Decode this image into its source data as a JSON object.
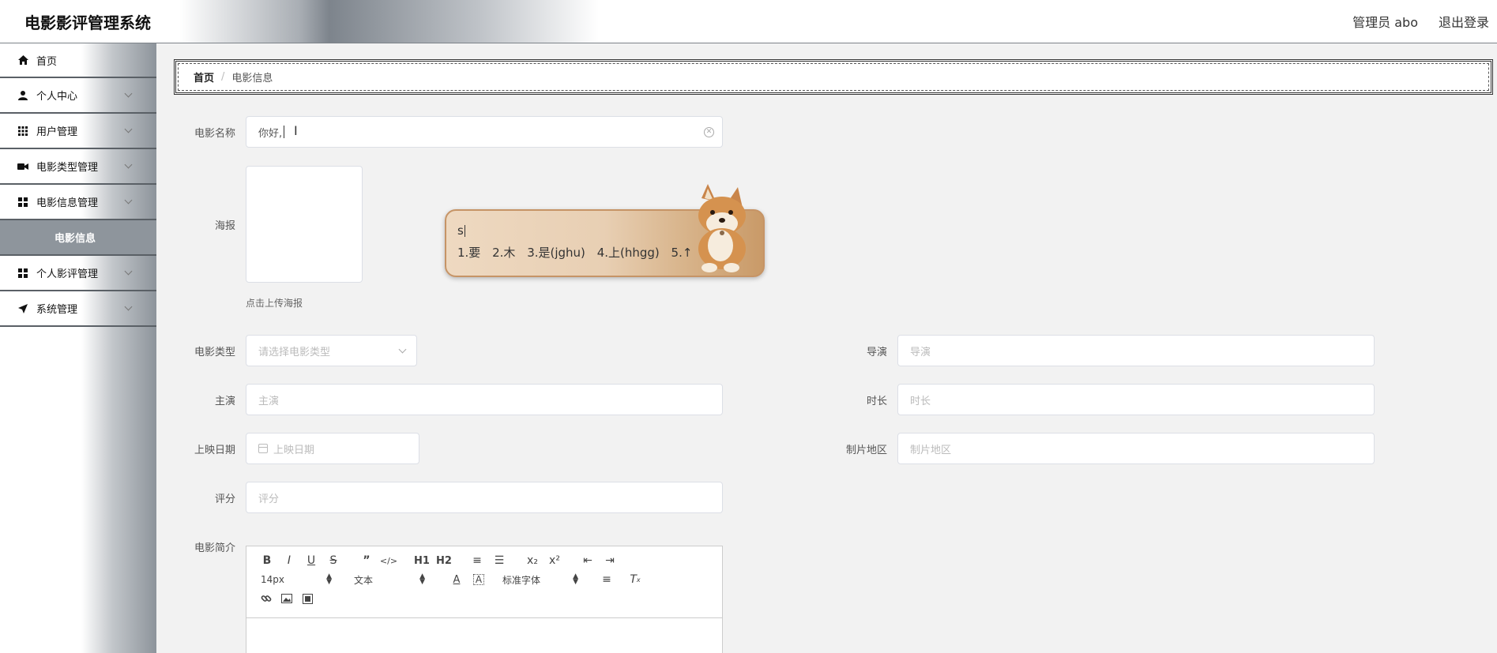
{
  "header": {
    "title": "电影影评管理系统",
    "user": "管理员 abo",
    "logout": "退出登录"
  },
  "sidebar": {
    "items": [
      {
        "label": "首页",
        "icon": "home-icon"
      },
      {
        "label": "个人中心",
        "icon": "user-icon"
      },
      {
        "label": "用户管理",
        "icon": "grid-icon"
      },
      {
        "label": "电影类型管理",
        "icon": "video-icon"
      },
      {
        "label": "电影信息管理",
        "icon": "apps-icon"
      },
      {
        "label": "电影信息",
        "icon": ""
      },
      {
        "label": "个人影评管理",
        "icon": "apps-icon"
      },
      {
        "label": "系统管理",
        "icon": "send-icon"
      }
    ]
  },
  "breadcrumb": {
    "home": "首页",
    "separator": "/",
    "current": "电影信息"
  },
  "form": {
    "movie_name": {
      "label": "电影名称",
      "value": "你好,"
    },
    "poster": {
      "label": "海报",
      "tip": "点击上传海报"
    },
    "movie_type": {
      "label": "电影类型",
      "placeholder": "请选择电影类型"
    },
    "director": {
      "label": "导演",
      "placeholder": "导演"
    },
    "actor": {
      "label": "主演",
      "placeholder": "主演"
    },
    "duration": {
      "label": "时长",
      "placeholder": "时长"
    },
    "release_date": {
      "label": "上映日期",
      "placeholder": "上映日期"
    },
    "region": {
      "label": "制片地区",
      "placeholder": "制片地区"
    },
    "rating": {
      "label": "评分",
      "placeholder": "评分"
    },
    "intro": {
      "label": "电影简介"
    }
  },
  "editor": {
    "font_size": "14px",
    "header_type": "文本",
    "font_family": "标准字体",
    "buttons_row1": [
      "B",
      "I",
      "U",
      "S",
      "”",
      "</>",
      "H1",
      "H2",
      "≡",
      "☰",
      "x₂",
      "x²",
      "⇤",
      "⇥"
    ]
  },
  "ime": {
    "composition": "s",
    "candidates": [
      "1.要",
      "2.木",
      "3.是(jghu)",
      "4.上(hhgg)",
      "5.↑"
    ]
  }
}
